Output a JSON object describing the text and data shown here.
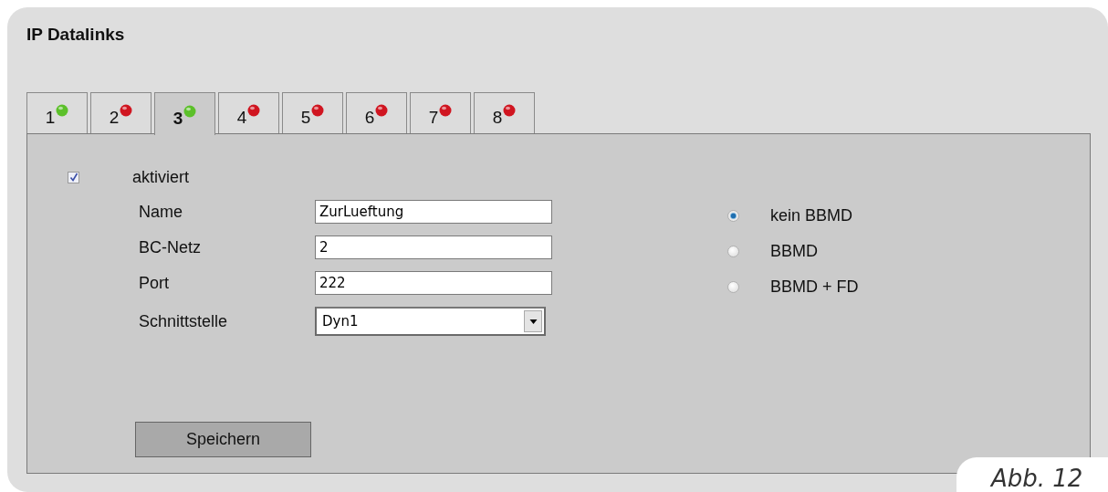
{
  "title": "IP Datalinks",
  "tabs": [
    {
      "label": "1",
      "selected": false,
      "color": "#5cc02a"
    },
    {
      "label": "2",
      "selected": false,
      "color": "#d01520"
    },
    {
      "label": "3",
      "selected": true,
      "color": "#5cc02a"
    },
    {
      "label": "4",
      "selected": false,
      "color": "#d01520"
    },
    {
      "label": "5",
      "selected": false,
      "color": "#d01520"
    },
    {
      "label": "6",
      "selected": false,
      "color": "#d01520"
    },
    {
      "label": "7",
      "selected": false,
      "color": "#d01520"
    },
    {
      "label": "8",
      "selected": false,
      "color": "#d01520"
    }
  ],
  "enabled": {
    "label": "aktiviert",
    "checked": true
  },
  "fields": [
    {
      "kind": "text",
      "label": "Name",
      "value": "ZurLueftung"
    },
    {
      "kind": "text",
      "label": "BC-Netz",
      "value": "2"
    },
    {
      "kind": "text",
      "label": "Port",
      "value": "222"
    },
    {
      "kind": "select",
      "label": "Schnittstelle",
      "value": "Dyn1"
    }
  ],
  "bbmd_options": [
    {
      "label": "kein BBMD",
      "selected": true
    },
    {
      "label": "BBMD",
      "selected": false
    },
    {
      "label": "BBMD + FD",
      "selected": false
    }
  ],
  "save_button": "Speichern",
  "caption": "Abb. 12"
}
